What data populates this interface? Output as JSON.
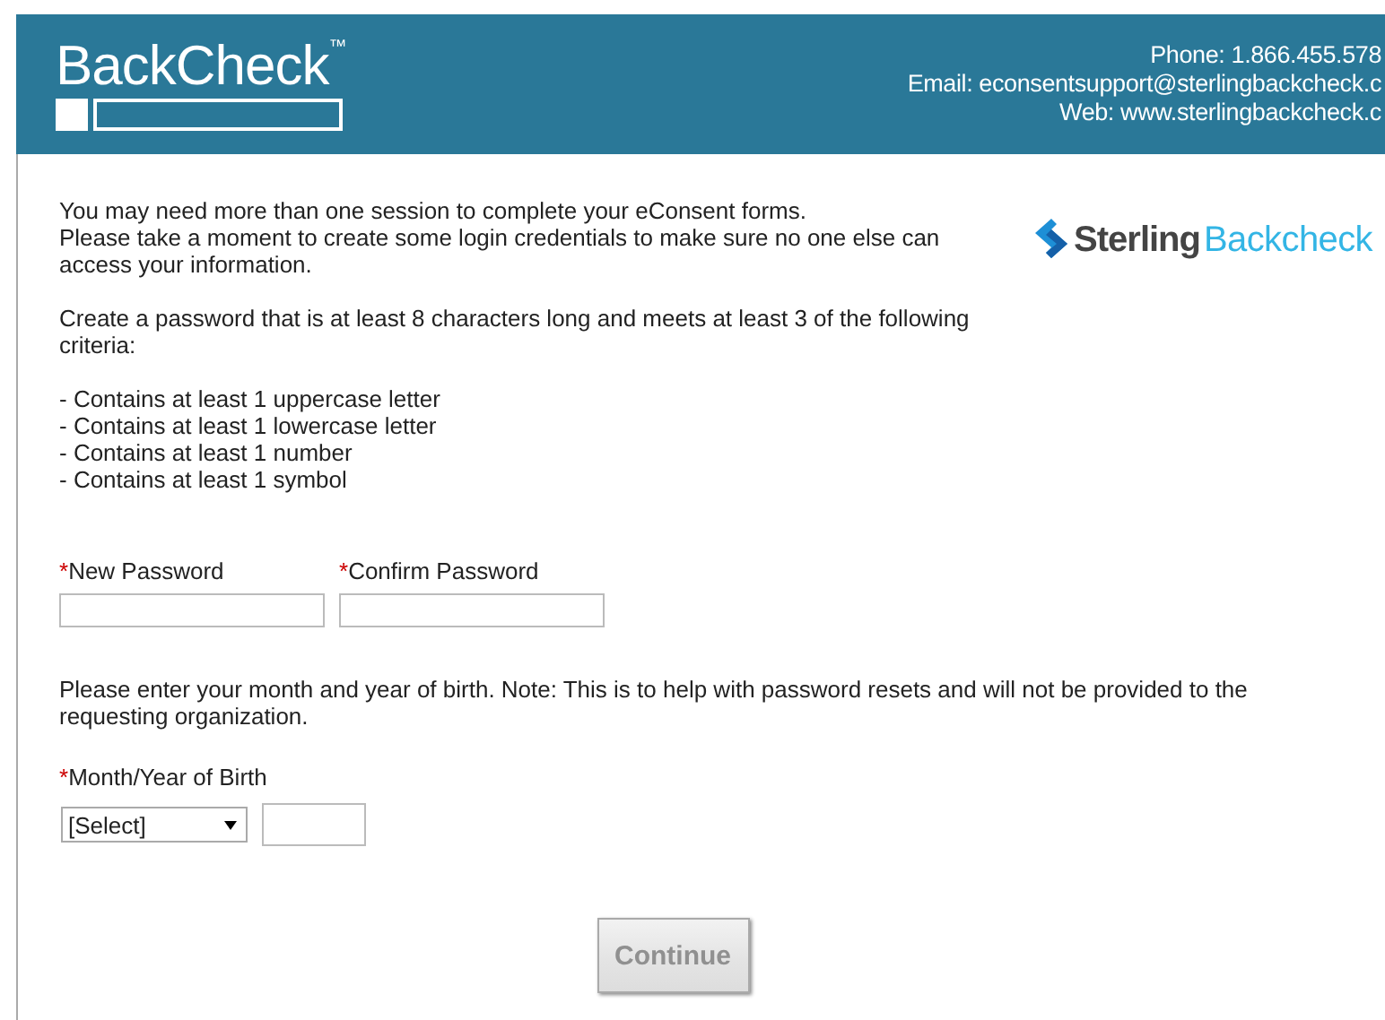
{
  "header": {
    "logo": "BackCheck",
    "trademark": "™",
    "contact": [
      "Phone: 1.866.455.578",
      "Email: econsentsupport@sterlingbackcheck.c",
      "Web: www.sterlingbackcheck.c"
    ]
  },
  "brand": {
    "first": "Sterling",
    "second": "Backcheck"
  },
  "intro": [
    "You may need more than one session to complete your eConsent forms.",
    "Please take a moment to create some login credentials to make sure no one else can access your information."
  ],
  "criteria_intro": "Create a password that is at least 8 characters long and meets at least 3 of the following criteria:",
  "criteria": [
    "- Contains at least 1 uppercase letter",
    "- Contains at least 1 lowercase letter",
    "- Contains at least 1 number",
    "- Contains at least 1 symbol"
  ],
  "password_fields": [
    {
      "required": "*",
      "label": "New Password"
    },
    {
      "required": "*",
      "label": "Confirm Password"
    }
  ],
  "birth_note": "Please enter your month and year of birth. Note: This is to help with password resets and will not be provided to the requesting organization.",
  "birth": {
    "required": "*",
    "label": "Month/Year of Birth",
    "select_value": "[Select]"
  },
  "continue_button": {
    "label": "Continue",
    "disabled": true
  }
}
